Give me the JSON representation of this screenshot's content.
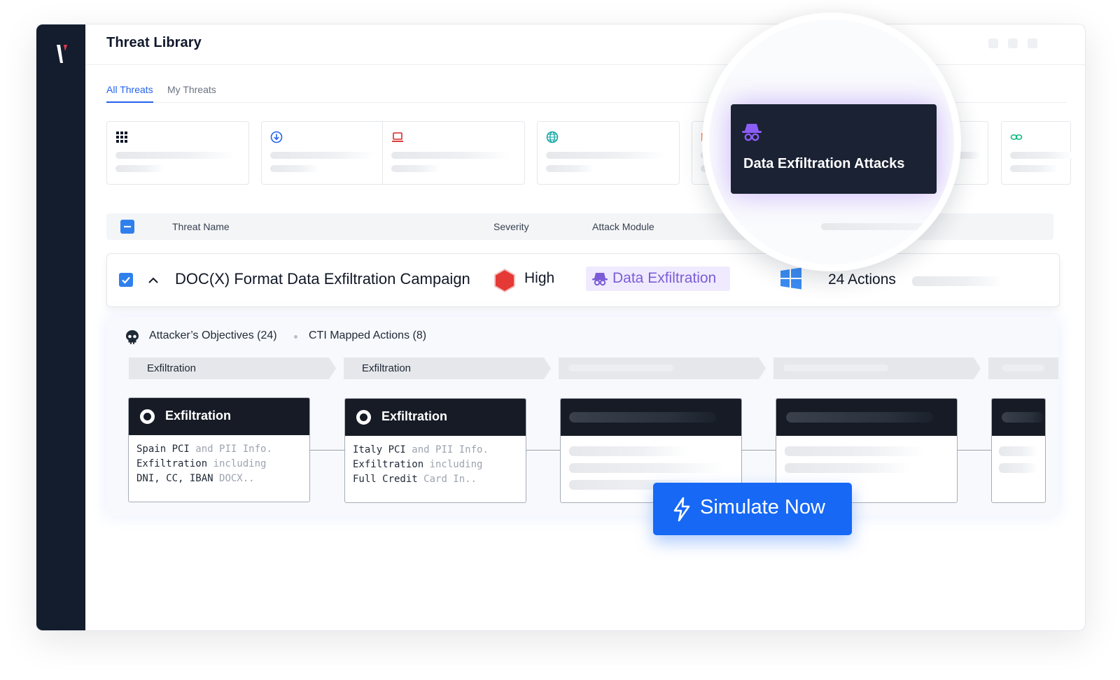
{
  "header": {
    "title": "Threat Library"
  },
  "tabs": [
    {
      "label": "All Threats",
      "active": true
    },
    {
      "label": "My Threats",
      "active": false
    }
  ],
  "categories": [
    {
      "icon": "grid-icon"
    },
    {
      "icon": "download-circle-icon"
    },
    {
      "icon": "laptop-icon"
    },
    {
      "icon": "globe-icon"
    },
    {
      "icon": "envelope-icon"
    },
    {
      "icon": "link-icon"
    }
  ],
  "table": {
    "columns": {
      "threat_name": "Threat Name",
      "severity": "Severity",
      "attack_module": "Attack Module"
    }
  },
  "row": {
    "name": "DOC(X) Format Data Exfiltration Campaign",
    "severity": "High",
    "module": "Data Exfiltration",
    "actions": "24 Actions",
    "platform_icon": "windows-icon"
  },
  "details": {
    "objectives": "Attacker’s Objectives (24)",
    "cti": "CTI Mapped Actions (8)",
    "phases": [
      "Exfiltration",
      "Exfiltration"
    ],
    "steps": [
      {
        "title": "Exfiltration",
        "line1a": "Spain PCI ",
        "line1b": "and PII Info.",
        "line2a": "Exfiltration ",
        "line2b": "including",
        "line3a": "DNI, CC, IBAN ",
        "line3b": "DOCX.."
      },
      {
        "title": "Exfiltration",
        "line1a": "Italy PCI ",
        "line1b": "and PII Info.",
        "line2a": "Exfiltration ",
        "line2b": "including",
        "line3a": "Full Credit ",
        "line3b": "Card In.."
      }
    ]
  },
  "zoom": {
    "title": "Data Exfiltration Attacks",
    "icon": "spy-icon"
  },
  "cta": {
    "label": "Simulate Now",
    "icon": "bolt-icon"
  },
  "colors": {
    "sidebar": "#141d2e",
    "primary": "#1668f5",
    "severity_high": "#e53935",
    "module": "#7c5cd6"
  }
}
